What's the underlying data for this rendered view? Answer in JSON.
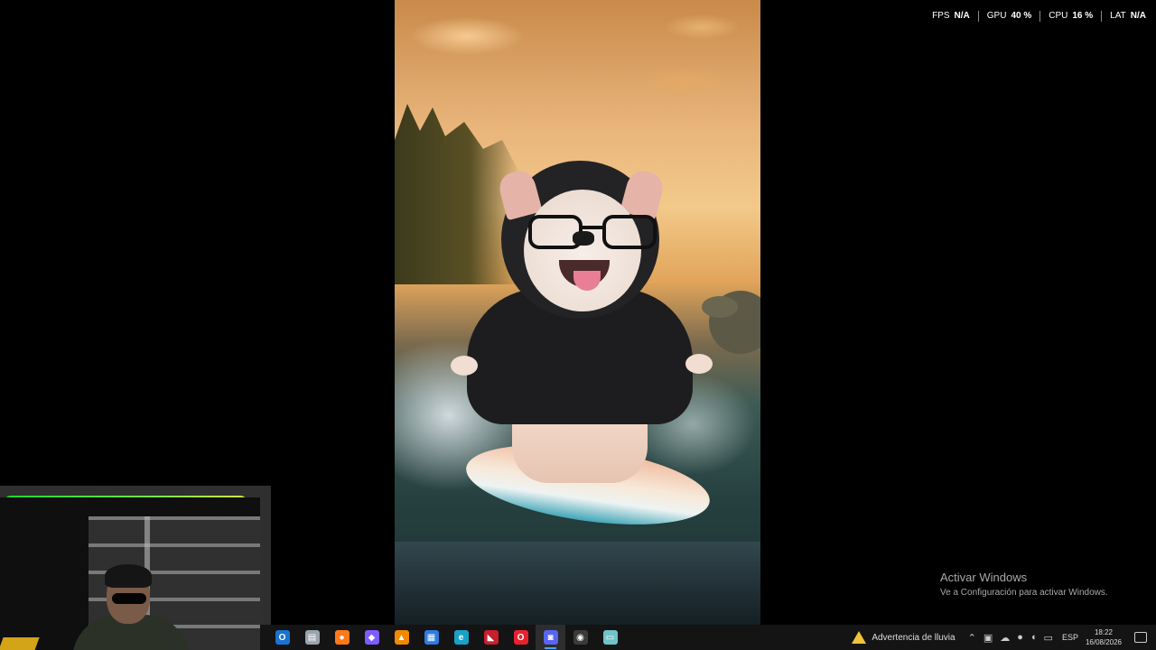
{
  "stats": [
    {
      "label": "FPS",
      "value": "N/A"
    },
    {
      "label": "GPU",
      "value": "40 %"
    },
    {
      "label": "CPU",
      "value": "16 %"
    },
    {
      "label": "LAT",
      "value": "N/A"
    }
  ],
  "watermark": {
    "title": "Activar Windows",
    "subtitle": "Ve a Configuración para activar Windows."
  },
  "taskbar": {
    "apps": [
      {
        "name": "outlook-icon",
        "glyph": "O",
        "color": "#1a73d1"
      },
      {
        "name": "file-explorer-icon",
        "glyph": "▤",
        "color": "#9aa3ad"
      },
      {
        "name": "firefox-icon",
        "glyph": "●",
        "color": "#ff7a1a"
      },
      {
        "name": "copilot-icon",
        "glyph": "◆",
        "color": "#7f5cff"
      },
      {
        "name": "vlc-icon",
        "glyph": "▲",
        "color": "#f08a00"
      },
      {
        "name": "microsoft-store-icon",
        "glyph": "▦",
        "color": "#2f7ce0"
      },
      {
        "name": "edge-icon",
        "glyph": "e",
        "color": "#1aa1c8"
      },
      {
        "name": "red-app-icon",
        "glyph": "◣",
        "color": "#c6202e"
      },
      {
        "name": "opera-icon",
        "glyph": "O",
        "color": "#e8212f"
      },
      {
        "name": "discord-icon",
        "glyph": "◙",
        "color": "#5865f2"
      },
      {
        "name": "obs-icon",
        "glyph": "◉",
        "color": "#3b3b3b"
      },
      {
        "name": "notepad-icon",
        "glyph": "▭",
        "color": "#6fc3c9"
      }
    ],
    "active_index": 9,
    "weather_text": "Advertencia de lluvia",
    "language": "ESP",
    "time": "18:22",
    "date": "16/08/2026"
  }
}
